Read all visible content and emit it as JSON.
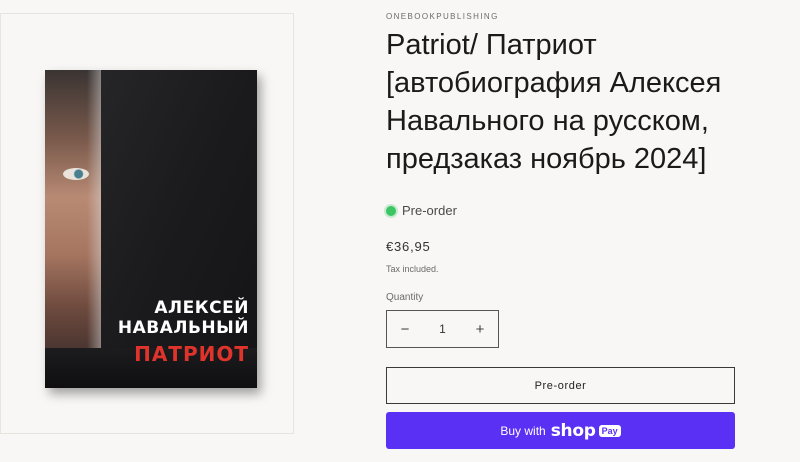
{
  "product": {
    "vendor": "ONEBOOKPUBLISHING",
    "title": "Patriot/ Патриот [автобиография Алексея Навального на русском, предзаказ ноябрь 2024]",
    "status": "Pre-order",
    "price": "€36,95",
    "tax_note": "Tax included.",
    "quantity_label": "Quantity",
    "quantity_value": "1",
    "decrease_symbol": "−",
    "increase_symbol": "+"
  },
  "cover": {
    "author_line1": "АЛЕКСЕЙ",
    "author_line2": "НАВАЛЬНЫЙ",
    "book_title": "ПАТРИОТ"
  },
  "buttons": {
    "preorder_label": "Pre-order",
    "buy_with_label": "Buy with",
    "shop_word": "shop",
    "pay_badge": "Pay"
  },
  "colors": {
    "status_dot": "#3cc563",
    "shop_pay_purple": "#5a31f4",
    "cover_title_red": "#e0332b"
  },
  "icons": [
    "status-dot-icon",
    "minus-icon",
    "plus-icon",
    "shop-pay-logo"
  ]
}
